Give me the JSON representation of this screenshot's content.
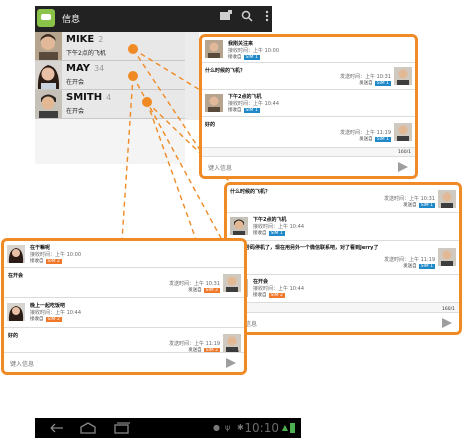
{
  "action_bar": {
    "app_title": "信息",
    "icons": [
      "compose-icon",
      "search-icon",
      "overflow-menu-icon"
    ]
  },
  "conversations": [
    {
      "name": "MIKE",
      "count": "2",
      "snippet": "下午2点的飞机"
    },
    {
      "name": "MAY",
      "count": "34",
      "snippet": "在开会"
    },
    {
      "name": "SMITH",
      "count": "4",
      "snippet": "在开会"
    }
  ],
  "panel1": {
    "messages": [
      {
        "side": "left",
        "text": "我刚关注来",
        "time": "接收时间：上午 10:00",
        "label": "接收自",
        "sim": "SIM 1"
      },
      {
        "side": "right",
        "text": "什么时候的飞机？",
        "time": "发送时间：上午 10:31",
        "label": "发送自",
        "sim": "SIM 1"
      },
      {
        "side": "left",
        "text": "下午2点的飞机",
        "time": "接收时间：上午 10:44",
        "label": "接收自",
        "sim": "SIM 1"
      },
      {
        "side": "right",
        "text": "好的",
        "time": "发送时间：上午 11:19",
        "label": "发送自",
        "sim": "SIM 1"
      }
    ],
    "counter": "160/1",
    "input_placeholder": "键入信息"
  },
  "panel2": {
    "messages": [
      {
        "side": "right",
        "text": "什么时候的飞机？",
        "time": "发送时间：上午 10:31",
        "label": "发送自",
        "sim": "SIM 1"
      },
      {
        "side": "left",
        "text": "下午2点的飞机",
        "time": "接收时间：上午 10:44",
        "label": "接收自",
        "sim": "SIM 1"
      },
      {
        "side": "right",
        "text": "我那个号码停机了，现在用另外一个微信联系吧，对了看到Jerry了吗？",
        "time": "发送时间：上午 11:19",
        "label": "发送自",
        "sim": "SIM 1"
      },
      {
        "side": "left",
        "text": "在开会",
        "time": "接收时间：上午 10:44",
        "label": "接收自",
        "sim": "SIM 2"
      }
    ],
    "counter": "160/1",
    "input_placeholder": "键入信息"
  },
  "panel3": {
    "messages": [
      {
        "side": "left",
        "text": "在干嘛呢",
        "time": "接收时间：上午 10:00",
        "label": "接收自",
        "sim": "SIM 2"
      },
      {
        "side": "right",
        "text": "在开会",
        "time": "发送时间：上午 10:31",
        "label": "发送自",
        "sim": "SIM 2"
      },
      {
        "side": "left",
        "text": "晚上一起吃饭吧",
        "time": "接收时间：上午 10:44",
        "label": "接收自",
        "sim": "SIM 2"
      },
      {
        "side": "right",
        "text": "好的",
        "time": "发送时间：上午 11:19",
        "label": "发送自",
        "sim": "SIM 2"
      }
    ],
    "counter": "160/1",
    "input_placeholder": "键入信息"
  },
  "status_bar": {
    "time": "10:10",
    "nav": [
      "back-icon",
      "home-icon",
      "recents-icon"
    ]
  },
  "colors": {
    "accent_orange": "#f08a24",
    "sim1_blue": "#1e88c8",
    "sim2_orange": "#f0782a"
  }
}
